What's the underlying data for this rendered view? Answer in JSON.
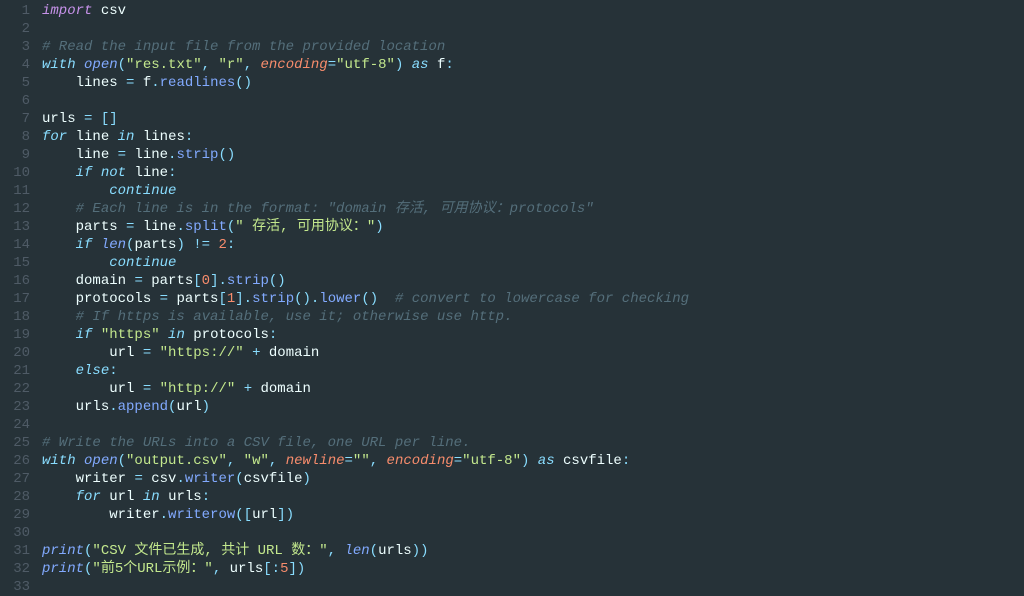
{
  "chart_data": null,
  "editor": {
    "lines": [
      {
        "n": "1",
        "tokens": [
          [
            "kw-import",
            "import"
          ],
          [
            "",
            " "
          ],
          [
            "module",
            "csv"
          ]
        ]
      },
      {
        "n": "2",
        "tokens": []
      },
      {
        "n": "3",
        "tokens": [
          [
            "comment",
            "# Read the input file from the provided location"
          ]
        ]
      },
      {
        "n": "4",
        "tokens": [
          [
            "kw-flow",
            "with"
          ],
          [
            "",
            " "
          ],
          [
            "builtin",
            "open"
          ],
          [
            "kw-op",
            "("
          ],
          [
            "string",
            "\"res.txt\""
          ],
          [
            "kw-op",
            ", "
          ],
          [
            "string",
            "\"r\""
          ],
          [
            "kw-op",
            ", "
          ],
          [
            "param",
            "encoding"
          ],
          [
            "kw-op",
            "="
          ],
          [
            "string",
            "\"utf-8\""
          ],
          [
            "kw-op",
            ") "
          ],
          [
            "kw-flow",
            "as"
          ],
          [
            "",
            " "
          ],
          [
            "ident",
            "f"
          ],
          [
            "kw-op",
            ":"
          ]
        ]
      },
      {
        "n": "5",
        "tokens": [
          [
            "",
            "    "
          ],
          [
            "ident",
            "lines"
          ],
          [
            "",
            " "
          ],
          [
            "kw-op",
            "="
          ],
          [
            "",
            " "
          ],
          [
            "ident",
            "f"
          ],
          [
            "kw-op",
            "."
          ],
          [
            "method",
            "readlines"
          ],
          [
            "kw-op",
            "()"
          ]
        ]
      },
      {
        "n": "6",
        "tokens": []
      },
      {
        "n": "7",
        "tokens": [
          [
            "ident",
            "urls"
          ],
          [
            "",
            " "
          ],
          [
            "kw-op",
            "="
          ],
          [
            "",
            " "
          ],
          [
            "kw-op",
            "[]"
          ]
        ]
      },
      {
        "n": "8",
        "tokens": [
          [
            "kw-flow",
            "for"
          ],
          [
            "",
            " "
          ],
          [
            "ident",
            "line"
          ],
          [
            "",
            " "
          ],
          [
            "kw-flow",
            "in"
          ],
          [
            "",
            " "
          ],
          [
            "ident",
            "lines"
          ],
          [
            "kw-op",
            ":"
          ]
        ]
      },
      {
        "n": "9",
        "tokens": [
          [
            "",
            "    "
          ],
          [
            "ident",
            "line"
          ],
          [
            "",
            " "
          ],
          [
            "kw-op",
            "="
          ],
          [
            "",
            " "
          ],
          [
            "ident",
            "line"
          ],
          [
            "kw-op",
            "."
          ],
          [
            "method",
            "strip"
          ],
          [
            "kw-op",
            "()"
          ]
        ]
      },
      {
        "n": "10",
        "tokens": [
          [
            "",
            "    "
          ],
          [
            "kw-flow",
            "if"
          ],
          [
            "",
            " "
          ],
          [
            "kw-flow",
            "not"
          ],
          [
            "",
            " "
          ],
          [
            "ident",
            "line"
          ],
          [
            "kw-op",
            ":"
          ]
        ]
      },
      {
        "n": "11",
        "tokens": [
          [
            "",
            "        "
          ],
          [
            "kw-flow",
            "continue"
          ]
        ]
      },
      {
        "n": "12",
        "tokens": [
          [
            "",
            "    "
          ],
          [
            "comment",
            "# Each line is in the format: \"domain 存活, 可用协议：protocols\""
          ]
        ]
      },
      {
        "n": "13",
        "tokens": [
          [
            "",
            "    "
          ],
          [
            "ident",
            "parts"
          ],
          [
            "",
            " "
          ],
          [
            "kw-op",
            "="
          ],
          [
            "",
            " "
          ],
          [
            "ident",
            "line"
          ],
          [
            "kw-op",
            "."
          ],
          [
            "method",
            "split"
          ],
          [
            "kw-op",
            "("
          ],
          [
            "string",
            "\" 存活, 可用协议：\""
          ],
          [
            "kw-op",
            ")"
          ]
        ]
      },
      {
        "n": "14",
        "tokens": [
          [
            "",
            "    "
          ],
          [
            "kw-flow",
            "if"
          ],
          [
            "",
            " "
          ],
          [
            "builtin",
            "len"
          ],
          [
            "kw-op",
            "("
          ],
          [
            "ident",
            "parts"
          ],
          [
            "kw-op",
            ") "
          ],
          [
            "kw-op",
            "!="
          ],
          [
            "",
            " "
          ],
          [
            "number",
            "2"
          ],
          [
            "kw-op",
            ":"
          ]
        ]
      },
      {
        "n": "15",
        "tokens": [
          [
            "",
            "        "
          ],
          [
            "kw-flow",
            "continue"
          ]
        ]
      },
      {
        "n": "16",
        "tokens": [
          [
            "",
            "    "
          ],
          [
            "ident",
            "domain"
          ],
          [
            "",
            " "
          ],
          [
            "kw-op",
            "="
          ],
          [
            "",
            " "
          ],
          [
            "ident",
            "parts"
          ],
          [
            "kw-op",
            "["
          ],
          [
            "number",
            "0"
          ],
          [
            "kw-op",
            "]."
          ],
          [
            "method",
            "strip"
          ],
          [
            "kw-op",
            "()"
          ]
        ]
      },
      {
        "n": "17",
        "tokens": [
          [
            "",
            "    "
          ],
          [
            "ident",
            "protocols"
          ],
          [
            "",
            " "
          ],
          [
            "kw-op",
            "="
          ],
          [
            "",
            " "
          ],
          [
            "ident",
            "parts"
          ],
          [
            "kw-op",
            "["
          ],
          [
            "number",
            "1"
          ],
          [
            "kw-op",
            "]."
          ],
          [
            "method",
            "strip"
          ],
          [
            "kw-op",
            "()."
          ],
          [
            "method",
            "lower"
          ],
          [
            "kw-op",
            "()  "
          ],
          [
            "comment",
            "# convert to lowercase for checking"
          ]
        ]
      },
      {
        "n": "18",
        "tokens": [
          [
            "",
            "    "
          ],
          [
            "comment",
            "# If https is available, use it; otherwise use http."
          ]
        ]
      },
      {
        "n": "19",
        "tokens": [
          [
            "",
            "    "
          ],
          [
            "kw-flow",
            "if"
          ],
          [
            "",
            " "
          ],
          [
            "string",
            "\"https\""
          ],
          [
            "",
            " "
          ],
          [
            "kw-flow",
            "in"
          ],
          [
            "",
            " "
          ],
          [
            "ident",
            "protocols"
          ],
          [
            "kw-op",
            ":"
          ]
        ]
      },
      {
        "n": "20",
        "tokens": [
          [
            "",
            "        "
          ],
          [
            "ident",
            "url"
          ],
          [
            "",
            " "
          ],
          [
            "kw-op",
            "="
          ],
          [
            "",
            " "
          ],
          [
            "string",
            "\"https://\""
          ],
          [
            "",
            " "
          ],
          [
            "kw-op",
            "+"
          ],
          [
            "",
            " "
          ],
          [
            "ident",
            "domain"
          ]
        ]
      },
      {
        "n": "21",
        "tokens": [
          [
            "",
            "    "
          ],
          [
            "kw-flow",
            "else"
          ],
          [
            "kw-op",
            ":"
          ]
        ]
      },
      {
        "n": "22",
        "tokens": [
          [
            "",
            "        "
          ],
          [
            "ident",
            "url"
          ],
          [
            "",
            " "
          ],
          [
            "kw-op",
            "="
          ],
          [
            "",
            " "
          ],
          [
            "string",
            "\"http://\""
          ],
          [
            "",
            " "
          ],
          [
            "kw-op",
            "+"
          ],
          [
            "",
            " "
          ],
          [
            "ident",
            "domain"
          ]
        ]
      },
      {
        "n": "23",
        "tokens": [
          [
            "",
            "    "
          ],
          [
            "ident",
            "urls"
          ],
          [
            "kw-op",
            "."
          ],
          [
            "method",
            "append"
          ],
          [
            "kw-op",
            "("
          ],
          [
            "ident",
            "url"
          ],
          [
            "kw-op",
            ")"
          ]
        ]
      },
      {
        "n": "24",
        "tokens": []
      },
      {
        "n": "25",
        "tokens": [
          [
            "comment",
            "# Write the URLs into a CSV file, one URL per line."
          ]
        ]
      },
      {
        "n": "26",
        "tokens": [
          [
            "kw-flow",
            "with"
          ],
          [
            "",
            " "
          ],
          [
            "builtin",
            "open"
          ],
          [
            "kw-op",
            "("
          ],
          [
            "string",
            "\"output.csv\""
          ],
          [
            "kw-op",
            ", "
          ],
          [
            "string",
            "\"w\""
          ],
          [
            "kw-op",
            ", "
          ],
          [
            "param",
            "newline"
          ],
          [
            "kw-op",
            "="
          ],
          [
            "string",
            "\"\""
          ],
          [
            "kw-op",
            ", "
          ],
          [
            "param",
            "encoding"
          ],
          [
            "kw-op",
            "="
          ],
          [
            "string",
            "\"utf-8\""
          ],
          [
            "kw-op",
            ") "
          ],
          [
            "kw-flow",
            "as"
          ],
          [
            "",
            " "
          ],
          [
            "ident",
            "csvfile"
          ],
          [
            "kw-op",
            ":"
          ]
        ]
      },
      {
        "n": "27",
        "tokens": [
          [
            "",
            "    "
          ],
          [
            "ident",
            "writer"
          ],
          [
            "",
            " "
          ],
          [
            "kw-op",
            "="
          ],
          [
            "",
            " "
          ],
          [
            "ident",
            "csv"
          ],
          [
            "kw-op",
            "."
          ],
          [
            "method",
            "writer"
          ],
          [
            "kw-op",
            "("
          ],
          [
            "ident",
            "csvfile"
          ],
          [
            "kw-op",
            ")"
          ]
        ]
      },
      {
        "n": "28",
        "tokens": [
          [
            "",
            "    "
          ],
          [
            "kw-flow",
            "for"
          ],
          [
            "",
            " "
          ],
          [
            "ident",
            "url"
          ],
          [
            "",
            " "
          ],
          [
            "kw-flow",
            "in"
          ],
          [
            "",
            " "
          ],
          [
            "ident",
            "urls"
          ],
          [
            "kw-op",
            ":"
          ]
        ]
      },
      {
        "n": "29",
        "tokens": [
          [
            "",
            "        "
          ],
          [
            "ident",
            "writer"
          ],
          [
            "kw-op",
            "."
          ],
          [
            "method",
            "writerow"
          ],
          [
            "kw-op",
            "(["
          ],
          [
            "ident",
            "url"
          ],
          [
            "kw-op",
            "])"
          ]
        ]
      },
      {
        "n": "30",
        "tokens": []
      },
      {
        "n": "31",
        "tokens": [
          [
            "builtin",
            "print"
          ],
          [
            "kw-op",
            "("
          ],
          [
            "string",
            "\"CSV 文件已生成, 共计 URL 数：\""
          ],
          [
            "kw-op",
            ", "
          ],
          [
            "builtin",
            "len"
          ],
          [
            "kw-op",
            "("
          ],
          [
            "ident",
            "urls"
          ],
          [
            "kw-op",
            "))"
          ]
        ]
      },
      {
        "n": "32",
        "tokens": [
          [
            "builtin",
            "print"
          ],
          [
            "kw-op",
            "("
          ],
          [
            "string",
            "\"前5个URL示例：\""
          ],
          [
            "kw-op",
            ", "
          ],
          [
            "ident",
            "urls"
          ],
          [
            "kw-op",
            "[:"
          ],
          [
            "number",
            "5"
          ],
          [
            "kw-op",
            "])"
          ]
        ]
      },
      {
        "n": "33",
        "tokens": []
      }
    ]
  }
}
